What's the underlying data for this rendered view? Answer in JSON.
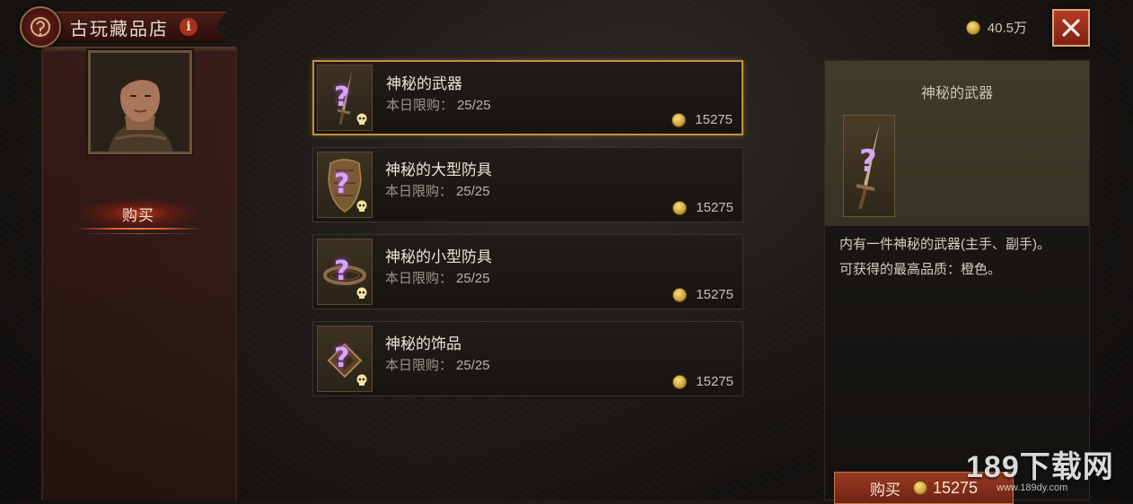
{
  "header": {
    "shop_title": "古玩藏品店",
    "info_symbol": "i",
    "currency_amount": "40.5万"
  },
  "sidebar": {
    "tab_buy": "购买"
  },
  "items": [
    {
      "name": "神秘的武器",
      "limit_label": "本日限购：",
      "limit_value": "25/25",
      "price": "15275",
      "icon": "mystery-weapon-icon"
    },
    {
      "name": "神秘的大型防具",
      "limit_label": "本日限购：",
      "limit_value": "25/25",
      "price": "15275",
      "icon": "mystery-large-armor-icon"
    },
    {
      "name": "神秘的小型防具",
      "limit_label": "本日限购：",
      "limit_value": "25/25",
      "price": "15275",
      "icon": "mystery-small-armor-icon"
    },
    {
      "name": "神秘的饰品",
      "limit_label": "本日限购：",
      "limit_value": "25/25",
      "price": "15275",
      "icon": "mystery-jewelry-icon"
    }
  ],
  "thumb_symbol": "?",
  "detail": {
    "title": "神秘的武器",
    "description_1": "内有一件神秘的武器(主手、副手)。",
    "description_2": "可获得的最高品质：橙色。"
  },
  "buy_button": {
    "label": "购买",
    "price": "15275"
  },
  "watermark": {
    "text": "189下载网",
    "url": "www.189dy.com"
  },
  "colors": {
    "accent_orange": "#c98e3c",
    "button_red": "#9a3a22",
    "mystery_purple": "#d8a6f5",
    "coin_gold": "#d3a73b"
  }
}
